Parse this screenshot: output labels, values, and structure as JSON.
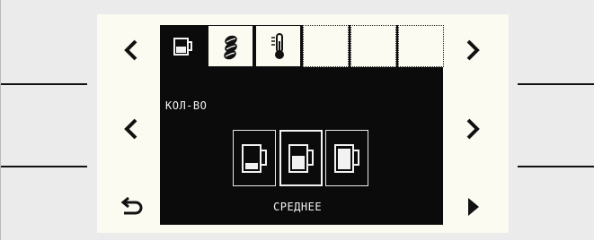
{
  "tabs": [
    {
      "icon": "cup-icon",
      "state": "active"
    },
    {
      "icon": "coffee-beans-icon",
      "state": "inactive"
    },
    {
      "icon": "thermometer-icon",
      "state": "inactive"
    },
    {
      "icon": "",
      "state": "empty"
    },
    {
      "icon": "",
      "state": "empty"
    },
    {
      "icon": "",
      "state": "empty"
    }
  ],
  "setting": {
    "title": "КОЛ-ВО",
    "options": [
      {
        "icon": "cup-small-icon",
        "fill_level": 0.3
      },
      {
        "icon": "cup-medium-icon",
        "fill_level": 0.6,
        "selected": true
      },
      {
        "icon": "cup-large-icon",
        "fill_level": 0.85
      }
    ],
    "current_value": "СРЕДНЕЕ"
  },
  "colors": {
    "screen": "#0b0b0b",
    "panel": "#fbfbf2",
    "text": "#f2f2f2"
  }
}
